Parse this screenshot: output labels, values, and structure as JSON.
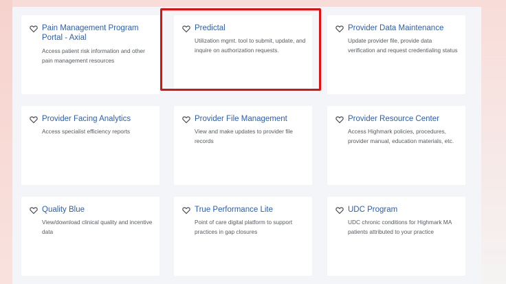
{
  "cards": [
    {
      "title": "Pain Management Program Portal - Axial",
      "description": "Access patient risk information and other pain management resources"
    },
    {
      "title": "Predictal",
      "description": "Utilization mgmt. tool to submit, update, and inquire on authorization requests."
    },
    {
      "title": "Provider Data Maintenance",
      "description": "Update provider file, provide data verification and request credentialing status"
    },
    {
      "title": "Provider Facing Analytics",
      "description": "Access specialist efficiency reports"
    },
    {
      "title": "Provider File Management",
      "description": "View and make updates to provider file records"
    },
    {
      "title": "Provider Resource Center",
      "description": "Access Highmark policies, procedures, provider manual, education materials, etc."
    },
    {
      "title": "Quality Blue",
      "description": "View/download clinical quality and incentive data"
    },
    {
      "title": "True Performance Lite",
      "description": "Point of care digital platform to support practices in gap closures"
    },
    {
      "title": "UDC Program",
      "description": "UDC chronic conditions for Highmark MA patients attributed to your practice"
    }
  ],
  "colors": {
    "title_link": "#2a5fb0",
    "highlight_border": "#e10f0f",
    "page_background": "#f4f5f8"
  },
  "icons": {
    "favorite": "heart-outline-icon"
  }
}
